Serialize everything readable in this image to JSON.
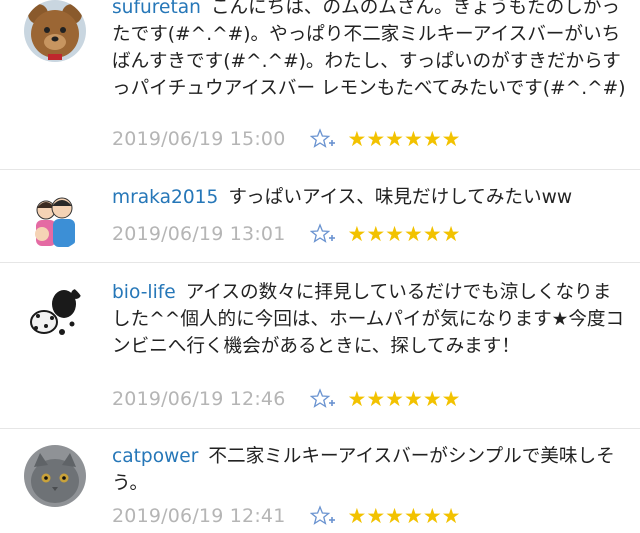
{
  "comments": [
    {
      "username": "sufuretan",
      "text": "こんにちは、のムのムさん。きょうもたのしかったです(#^.^#)。やっぱり不二家ミルキーアイスバーがいちばんすきです(#^.^#)。わたし、すっぱいのがすきだからすっパイチュウアイスバー レモンもたべてみたいです(#^.^#)",
      "timestamp": "2019/06/19 15:00",
      "stars": "★★★★★★",
      "avatar": "teddy-bear"
    },
    {
      "username": "mraka2015",
      "text": "すっぱいアイス、味見だけしてみたいww",
      "timestamp": "2019/06/19 13:01",
      "stars": "★★★★★★",
      "avatar": "family-illustration"
    },
    {
      "username": "bio-life",
      "text": "アイスの数々に拝見しているだけでも涼しくなりました^^個人的に今回は、ホームパイが気になります★今度コンビニへ行く機会があるときに、探してみます！",
      "timestamp": "2019/06/19 12:46",
      "stars": "★★★★★★",
      "avatar": "bw-dog-pattern"
    },
    {
      "username": "catpower",
      "text": "不二家ミルキーアイスバーがシンプルで美味しそう。",
      "timestamp": "2019/06/19 12:41",
      "stars": "★★★★★★",
      "avatar": "grey-cat"
    }
  ],
  "colors": {
    "username": "#2677b8",
    "timestamp": "#b5b5b5",
    "star": "#f2c200",
    "add_star_icon": "#6a93d0"
  },
  "icons": {
    "add_star": "add-star-icon"
  }
}
